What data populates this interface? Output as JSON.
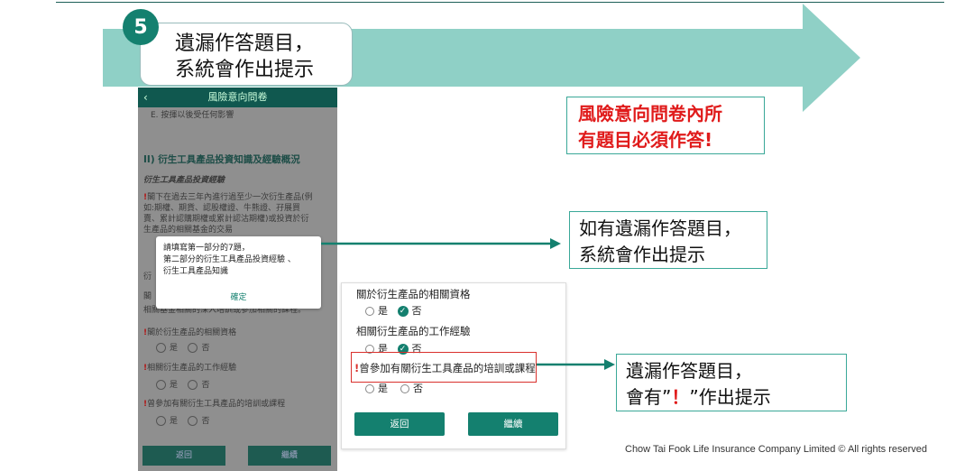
{
  "step": {
    "number": "5",
    "line1": "遺漏作答題目，",
    "line2": "系統會作出提示"
  },
  "phone": {
    "header_title": "風險意向問卷",
    "back": "‹",
    "top_item": "E. 按揮以後受任何影響",
    "section_title": "II) 衍生工具產品投資知識及經驗概況",
    "sub_title": "衍生工具產品投資經驗",
    "q7_line1": "閣下在過去三年內進行過至少一次衍生產品(例",
    "q7_line2": "如:期權、期貨、認股權證、牛熊證、孖展買",
    "q7_line3": "賣、累計認購期權或累計認沽期權)或投資於衍",
    "q7_line4": "生產品的相關基金的交易",
    "side_frag_1": "衍",
    "side_frag_2": "閣",
    "frag_line": "相關基金相關的深入培訓或參加相關的課程。",
    "q_a": "閣於衍生產品的相關資格",
    "q_b": "相關衍生產品的工作經驗",
    "q_c": "曾參加有關衍生工具產品的培訓或課程",
    "yes": "是",
    "no": "否",
    "back_btn": "返回",
    "next_btn": "繼續",
    "exclaim": "!"
  },
  "dialog": {
    "line1": "請填寫第一部分的7題，",
    "line2": "第二部分的衍生工具產品投資經驗 、",
    "line3": "衍生工具產品知識",
    "ok": "確定"
  },
  "panel": {
    "q1": "關於衍生產品的相關資格",
    "q2": "相關衍生產品的工作經驗",
    "q3": "曾參加有關衍生工具產品的培訓或課程",
    "exclaim": "!",
    "yes": "是",
    "no": "否",
    "check": "✓",
    "back_btn": "返回",
    "next_btn": "繼續"
  },
  "callouts": {
    "red_line1": "風險意向問卷內所",
    "red_line2": "有題目必須作答!",
    "mid_line1": "如有遺漏作答題目，",
    "mid_line2": "系統會作出提示",
    "bottom_line1": "遺漏作答題目，",
    "bottom_line2_a": "會有”",
    "bottom_line2_b": "！",
    "bottom_line2_c": "”作出提示"
  },
  "footer": "Chow Tai Fook Life Insurance Company Limited © All rights reserved",
  "colors": {
    "teal": "#14806f",
    "arrow": "#8fd0c6",
    "red": "#e01b1b"
  }
}
